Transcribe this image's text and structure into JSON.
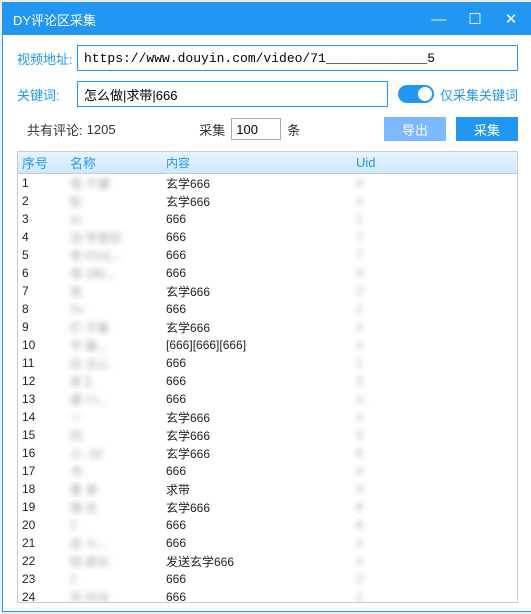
{
  "window": {
    "title": "DY评论区采集"
  },
  "form": {
    "videoLabel": "视频地址:",
    "videoValue": "https://www.douyin.com/video/71_____________5",
    "keywordLabel": "关键词:",
    "keywordValue": "怎么做|求带|666",
    "onlyKeywordLabel": "仅采集关键词"
  },
  "meta": {
    "totalLabel": "共有评论:",
    "totalValue": "1205",
    "collectLabel": "采集",
    "collectCount": "100",
    "collectUnit": "条",
    "exportLabel": "导出",
    "startLabel": "采集"
  },
  "table": {
    "headers": {
      "seq": "序号",
      "name": "名称",
      "content": "内容",
      "uid": "Uid"
    },
    "rows": [
      {
        "seq": "1",
        "name": "怪    不谦",
        "content": "玄学666",
        "uid": "4          "
      },
      {
        "seq": "2",
        "name": "彭        ",
        "content": "玄学666",
        "uid": "1          "
      },
      {
        "seq": "3",
        "name": "xc        ",
        "content": "666",
        "uid": "1          "
      },
      {
        "seq": "4",
        "name": "泊    专营店",
        "content": "666",
        "uid": "7          "
      },
      {
        "seq": "5",
        "name": "老    POS...",
        "content": "666",
        "uid": "7          "
      },
      {
        "seq": "6",
        "name": "用    396...",
        "content": "666",
        "uid": "4          "
      },
      {
        "seq": "7",
        "name": "张        ",
        "content": "玄学666",
        "uid": "2          "
      },
      {
        "seq": "8",
        "name": "Sc        ",
        "content": "666",
        "uid": "1          "
      },
      {
        "seq": "9",
        "name": "打    不着",
        "content": "玄学666",
        "uid": "1          "
      },
      {
        "seq": "10",
        "name": "宇    最...",
        "content": "[666][666][666]",
        "uid": "1  "
      },
      {
        "seq": "11",
        "name": "应    主心",
        "content": "666",
        "uid": "1          "
      },
      {
        "seq": "12",
        "name": "老    】  ",
        "content": "666",
        "uid": "3          "
      },
      {
        "seq": "13",
        "name": "建    川...",
        "content": "666",
        "uid": "1.         "
      },
      {
        "seq": "14",
        "name": "一        ",
        "content": "玄学666",
        "uid": "1          "
      },
      {
        "seq": "15",
        "name": "四        ",
        "content": "玄学666",
        "uid": "3          "
      },
      {
        "seq": "16",
        "name": "小    .39",
        "content": "玄学666",
        "uid": "6          "
      },
      {
        "seq": "17",
        "name": "书        ",
        "content": "666",
        "uid": "4          "
      },
      {
        "seq": "18",
        "name": "夏    录  ",
        "content": "求带",
        "uid": "3          "
      },
      {
        "seq": "19",
        "name": "强    合  ",
        "content": "玄学666",
        "uid": "8          "
      },
      {
        "seq": "20",
        "name": "2         ",
        "content": "666",
        "uid": "8          "
      },
      {
        "seq": "21",
        "name": "走    々...",
        "content": "666",
        "uid": "1          "
      },
      {
        "seq": "22",
        "name": "短    部长",
        "content": "发送玄学666",
        "uid": "1      "
      },
      {
        "seq": "23",
        "name": "2         ",
        "content": "666",
        "uid": "2          "
      },
      {
        "seq": "24",
        "name": "写    时光",
        "content": "666",
        "uid": "1          "
      }
    ]
  }
}
